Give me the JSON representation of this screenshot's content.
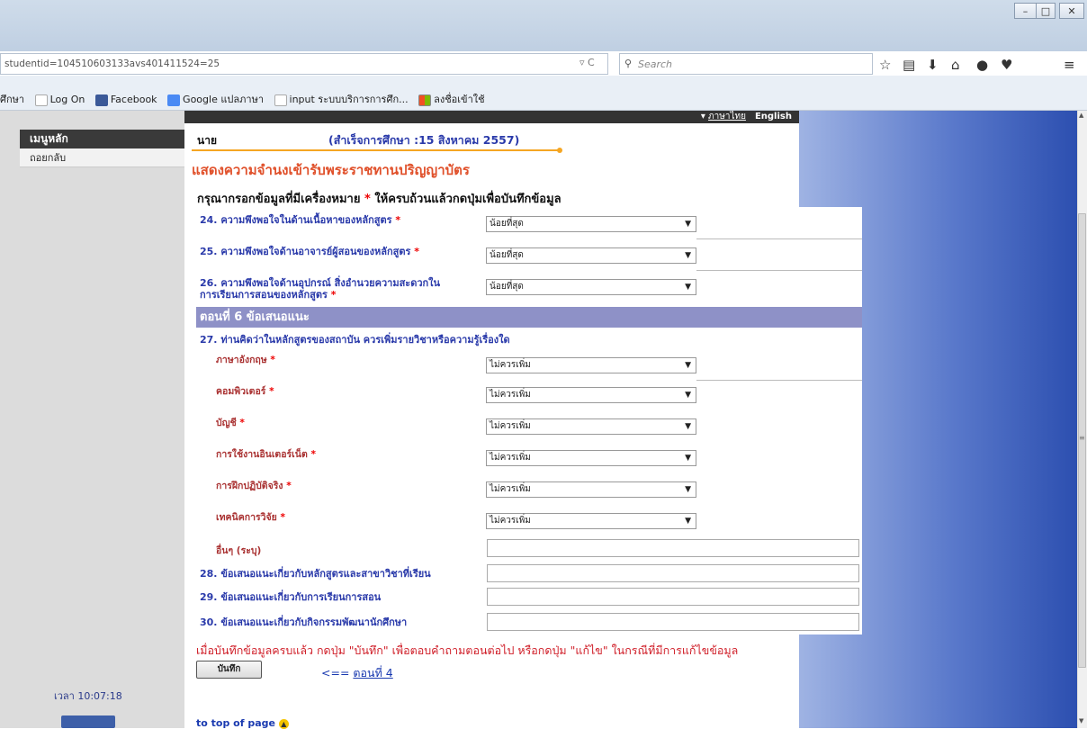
{
  "browser": {
    "url": "studentid=104510603133avs401411524=25",
    "search_placeholder": "Search",
    "bookmarks": [
      "ศึกษา",
      "Log On",
      "Facebook",
      "Google แปลภาษา",
      "input ระบบบริการการศึก...",
      "ลงชื่อเข้าใช้"
    ]
  },
  "lang": {
    "thai": "ภาษาไทย",
    "english": "English"
  },
  "sidebar": {
    "main_menu": "เมนูหลัก",
    "back": "ถอยกลับ",
    "clock": "เวลา 10:07:18"
  },
  "header": {
    "user": "นาย",
    "graduation": "(สำเร็จการศึกษา :15 สิงหาคม 2557)",
    "title": "แสดงความจำนงเข้ารับพระราชทานปริญญาบัตร",
    "instruction_pre": "กรุณากรอกข้อมูลที่มีเครื่องหมาย ",
    "instruction_star": "*",
    "instruction_post": " ให้ครบถ้วนแล้วกดปุ่มเพื่อบันทึกข้อมูล"
  },
  "form": {
    "q24": {
      "label": "24. ความพึงพอใจในด้านเนื้อหาของหลักสูตร",
      "value": "น้อยที่สุด"
    },
    "q25": {
      "label": "25. ความพึงพอใจด้านอาจารย์ผู้สอนของหลักสูตร",
      "value": "น้อยที่สุด"
    },
    "q26": {
      "label_line1": "26. ความพึงพอใจด้านอุปกรณ์ สิ่งอำนวยความสะดวกใน",
      "label_line2": "การเรียนการสอนของหลักสูตร",
      "value": "น้อยที่สุด"
    },
    "section6": "ตอนที่ 6 ข้อเสนอแนะ",
    "q27": {
      "label": "27. ท่านคิดว่าในหลักสูตรของสถาบัน ควรเพิ่มรายวิชาหรือความรู้เรื่องใด",
      "items": [
        {
          "label": "ภาษาอังกฤษ",
          "value": "ไม่ควรเพิ่ม"
        },
        {
          "label": "คอมพิวเตอร์",
          "value": "ไม่ควรเพิ่ม"
        },
        {
          "label": "บัญชี",
          "value": "ไม่ควรเพิ่ม"
        },
        {
          "label": "การใช้งานอินเตอร์เน็ต",
          "value": "ไม่ควรเพิ่ม"
        },
        {
          "label": "การฝึกปฏิบัติจริง",
          "value": "ไม่ควรเพิ่ม"
        },
        {
          "label": "เทคนิคการวิจัย",
          "value": "ไม่ควรเพิ่ม"
        }
      ],
      "other_label": "อื่นๆ (ระบุ)",
      "other_value": ""
    },
    "q28": {
      "label": "28. ข้อเสนอแนะเกี่ยวกับหลักสูตรและสาขาวิชาที่เรียน",
      "value": ""
    },
    "q29": {
      "label": "29. ข้อเสนอแนะเกี่ยวกับการเรียนการสอน",
      "value": ""
    },
    "q30": {
      "label": "30. ข้อเสนอแนะเกี่ยวกับกิจกรรมพัฒนานักศึกษา",
      "value": ""
    },
    "required_mark": "*"
  },
  "footer": {
    "note": "เมื่อบันทึกข้อมูลครบแล้ว กดปุ่ม \"บันทึก\" เพื่อตอบคำถามตอนต่อไป หรือกดปุ่ม \"แก้ไข\" ในกรณีที่มีการแก้ไขข้อมูล",
    "save_label": "บันทึก",
    "back_arrow": "<== ",
    "back_label": "ตอนที่ 4",
    "to_top": "to top of page"
  },
  "icons": {
    "toolbar": [
      "star-icon",
      "reading-list-icon",
      "download-icon",
      "home-icon",
      "chat-icon",
      "pocket-icon",
      "menu-icon"
    ]
  }
}
